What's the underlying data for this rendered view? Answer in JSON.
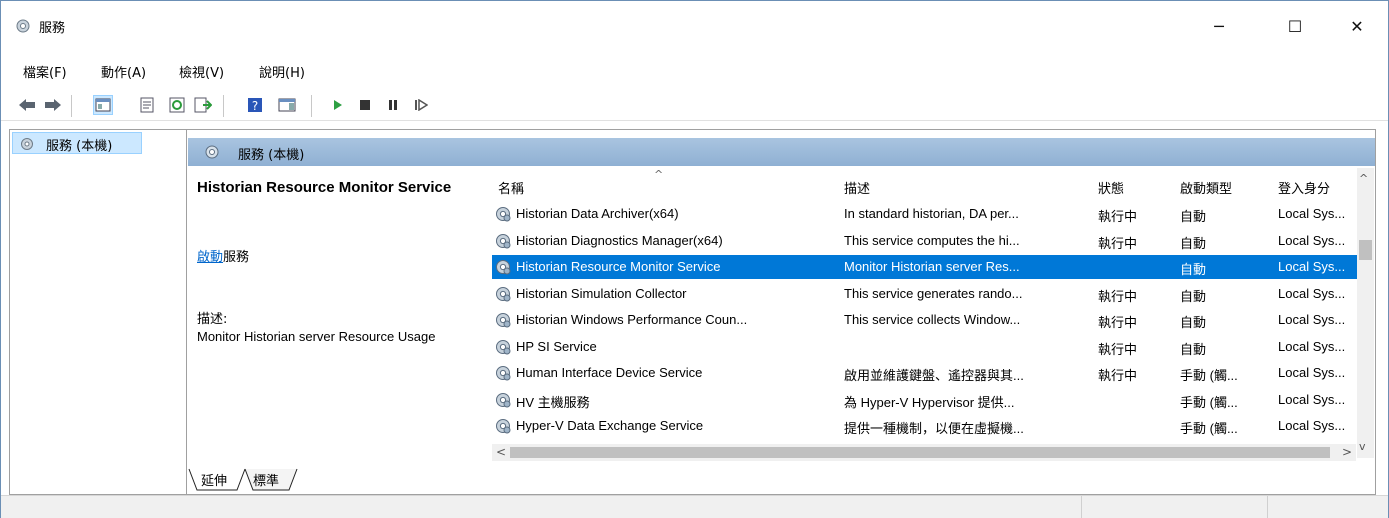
{
  "window": {
    "title": "服務"
  },
  "window_controls": {
    "minimize": "─",
    "maximize": "☐",
    "close": "✕"
  },
  "menu": [
    "檔案(F)",
    "動作(A)",
    "檢視(V)",
    "說明(H)"
  ],
  "toolbar": {
    "icons": [
      "back-arrow-icon",
      "forward-arrow-icon",
      "show-hide-tree-icon",
      "properties-icon",
      "refresh-icon",
      "export-list-icon",
      "help-icon",
      "show-action-pane-icon",
      "start-service-icon",
      "stop-service-icon",
      "pause-service-icon",
      "resume-service-icon"
    ]
  },
  "tree": {
    "selected_label": "服務 (本機)"
  },
  "header": {
    "label": "服務 (本機)"
  },
  "detail": {
    "title": "Historian Resource Monitor Service",
    "start_link": "啟動",
    "start_suffix": "服務",
    "description_label": "描述:",
    "description": "Monitor Historian server Resource Usage"
  },
  "columns": [
    "名稱",
    "描述",
    "狀態",
    "啟動類型",
    "登入身分"
  ],
  "rows": [
    {
      "name": "Historian Data Archiver(x64)",
      "description": "In standard historian, DA per...",
      "status": "執行中",
      "startup": "自動",
      "logon": "Local Sys..."
    },
    {
      "name": "Historian Diagnostics Manager(x64)",
      "description": "This service computes the hi...",
      "status": "執行中",
      "startup": "自動",
      "logon": "Local Sys..."
    },
    {
      "name": "Historian Resource Monitor Service",
      "description": "Monitor Historian server Res...",
      "status": "",
      "startup": "自動",
      "logon": "Local Sys..."
    },
    {
      "name": "Historian Simulation Collector",
      "description": "This service generates rando...",
      "status": "執行中",
      "startup": "自動",
      "logon": "Local Sys..."
    },
    {
      "name": "Historian Windows Performance Coun...",
      "description": "This service collects Window...",
      "status": "執行中",
      "startup": "自動",
      "logon": "Local Sys..."
    },
    {
      "name": "HP SI Service",
      "description": "",
      "status": "執行中",
      "startup": "自動",
      "logon": "Local Sys..."
    },
    {
      "name": "Human Interface Device Service",
      "description": "啟用並維護鍵盤、遙控器與其...",
      "status": "執行中",
      "startup": "手動 (觸...",
      "logon": "Local Sys..."
    },
    {
      "name": "HV 主機服務",
      "description": "為 Hyper-V Hypervisor 提供...",
      "status": "",
      "startup": "手動 (觸...",
      "logon": "Local Sys..."
    },
    {
      "name": "Hyper-V Data Exchange Service",
      "description": "提供一種機制，以便在虛擬機...",
      "status": "",
      "startup": "手動 (觸...",
      "logon": "Local Sys..."
    }
  ],
  "selected_row_index": 2,
  "scroll": {
    "up": "^",
    "down": "v",
    "left": "<",
    "right": ">"
  },
  "tabs": [
    "延伸",
    "標準"
  ],
  "colors": {
    "selection": "#0078d7",
    "header_band": "#9dbbdc",
    "link": "#0066cc"
  }
}
